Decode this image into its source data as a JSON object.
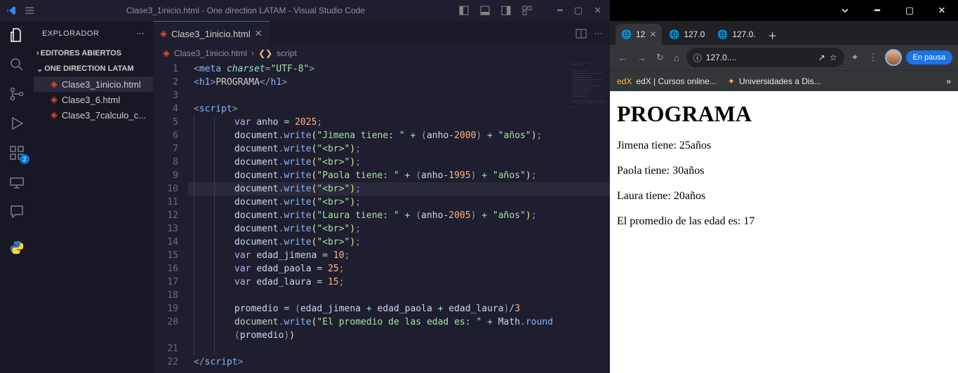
{
  "vscode": {
    "title": "Clase3_1inicio.html - One direction LATAM - Visual Studio Code",
    "explorer_label": "EXPLORADOR",
    "editors_open": "EDITORES ABIERTOS",
    "project_name": "ONE DIRECTION LATAM",
    "files": [
      "Clase3_1inicio.html",
      "Clase3_6.html",
      "Clase3_7calculo_c..."
    ],
    "tab_name": "Clase3_1inicio.html",
    "breadcrumb_file": "Clase3_1inicio.html",
    "breadcrumb_symbol": "script",
    "badge": "2",
    "lines": [
      {
        "n": 1,
        "html": "<span class='punct'>&lt;</span><span class='tag'>meta</span> <span class='attr'>charset</span><span class='punct'>=</span><span class='str'>\"UTF-8\"</span><span class='punct'>&gt;</span>",
        "indent": 0
      },
      {
        "n": 2,
        "html": "<span class='punct'>&lt;</span><span class='tag'>h1</span><span class='punct'>&gt;</span>PROGRAMA<span class='punct'>&lt;/</span><span class='tag'>h1</span><span class='punct'>&gt;</span>",
        "indent": 0
      },
      {
        "n": 3,
        "html": "",
        "indent": 0
      },
      {
        "n": 4,
        "html": "<span class='punct'>&lt;</span><span class='tag'>script</span><span class='punct'>&gt;</span>",
        "indent": 0
      },
      {
        "n": 5,
        "html": "<span class='kw'>var</span> <span class='var'>anho</span> <span class='op'>=</span> <span class='num'>2025</span><span class='punct'>;</span>",
        "indent": 2
      },
      {
        "n": 6,
        "html": "<span class='obj'>document</span><span class='punct'>.</span><span class='fn'>write</span><span class='bracket'>(</span><span class='str'>\"Jimena tiene: \"</span> <span class='op'>+</span> <span class='punct'>(</span><span class='var'>anho</span><span class='op'>-</span><span class='num'>2000</span><span class='punct'>)</span> <span class='op'>+</span> <span class='str'>\"años\"</span><span class='bracket'>)</span><span class='punct'>;</span>",
        "indent": 2
      },
      {
        "n": 7,
        "html": "<span class='obj'>document</span><span class='punct'>.</span><span class='fn'>write</span><span class='bracket'>(</span><span class='str'>\"&lt;br&gt;\"</span><span class='bracket'>)</span><span class='punct'>;</span>",
        "indent": 2
      },
      {
        "n": 8,
        "html": "<span class='obj'>document</span><span class='punct'>.</span><span class='fn'>write</span><span class='bracket'>(</span><span class='str'>\"&lt;br&gt;\"</span><span class='bracket'>)</span><span class='punct'>;</span>",
        "indent": 2
      },
      {
        "n": 9,
        "html": "<span class='obj'>document</span><span class='punct'>.</span><span class='fn'>write</span><span class='bracket'>(</span><span class='str'>\"Paola tiene: \"</span> <span class='op'>+</span> <span class='punct'>(</span><span class='var'>anho</span><span class='op'>-</span><span class='num'>1995</span><span class='punct'>)</span> <span class='op'>+</span> <span class='str'>\"años\"</span><span class='bracket'>)</span><span class='punct'>;</span>",
        "indent": 2
      },
      {
        "n": 10,
        "html": "<span class='obj'>document</span><span class='punct'>.</span><span class='fn'>write</span><span class='bracket'>(</span><span class='str'>\"&lt;br&gt;\"</span><span class='bracket'>)</span><span class='punct'>;</span>",
        "indent": 2,
        "hl": true
      },
      {
        "n": 11,
        "html": "<span class='obj'>document</span><span class='punct'>.</span><span class='fn'>write</span><span class='bracket'>(</span><span class='str'>\"&lt;br&gt;\"</span><span class='bracket'>)</span><span class='punct'>;</span>",
        "indent": 2
      },
      {
        "n": 12,
        "html": "<span class='obj'>document</span><span class='punct'>.</span><span class='fn'>write</span><span class='bracket'>(</span><span class='str'>\"Laura tiene: \"</span> <span class='op'>+</span> <span class='punct'>(</span><span class='var'>anho</span><span class='op'>-</span><span class='num'>2005</span><span class='punct'>)</span> <span class='op'>+</span> <span class='str'>\"años\"</span><span class='bracket'>)</span><span class='punct'>;</span>",
        "indent": 2
      },
      {
        "n": 13,
        "html": "<span class='obj'>document</span><span class='punct'>.</span><span class='fn'>write</span><span class='bracket'>(</span><span class='str'>\"&lt;br&gt;\"</span><span class='bracket'>)</span><span class='punct'>;</span>",
        "indent": 2
      },
      {
        "n": 14,
        "html": "<span class='obj'>document</span><span class='punct'>.</span><span class='fn'>write</span><span class='bracket'>(</span><span class='str'>\"&lt;br&gt;\"</span><span class='bracket'>)</span><span class='punct'>;</span>",
        "indent": 2
      },
      {
        "n": 15,
        "html": "<span class='kw'>var</span> <span class='var'>edad_jimena</span> <span class='op'>=</span> <span class='num'>10</span><span class='punct'>;</span>",
        "indent": 2
      },
      {
        "n": 16,
        "html": "<span class='kw'>var</span> <span class='var'>edad_paola</span> <span class='op'>=</span> <span class='num'>25</span><span class='punct'>;</span>",
        "indent": 2
      },
      {
        "n": 17,
        "html": "<span class='kw'>var</span> <span class='var'>edad_laura</span> <span class='op'>=</span> <span class='num'>15</span><span class='punct'>;</span>",
        "indent": 2
      },
      {
        "n": 18,
        "html": "",
        "indent": 2
      },
      {
        "n": 19,
        "html": "<span class='var'>promedio</span> <span class='op'>=</span> <span class='punct'>(</span><span class='var'>edad_jimena</span> <span class='op'>+</span> <span class='var'>edad_paola</span> <span class='op'>+</span> <span class='var'>edad_laura</span><span class='punct'>)</span><span class='op'>/</span><span class='num'>3</span>",
        "indent": 2
      },
      {
        "n": 20,
        "html": "<span class='obj'>document</span><span class='punct'>.</span><span class='fn'>write</span><span class='bracket'>(</span><span class='str'>\"El promedio de las edad es: \"</span> <span class='op'>+</span> <span class='var'>Math</span><span class='punct'>.</span><span class='fn'>round</span><span class='punct'>(</span><span class='var'>promedio</span><span class='punct'>)</span><span class='bracket'>)</span>",
        "indent": 2,
        "wrap": true
      },
      {
        "n": 21,
        "html": "",
        "indent": 2
      },
      {
        "n": 22,
        "html": "<span class='punct'>&lt;/</span><span class='tag'>script</span><span class='punct'>&gt;</span>",
        "indent": 0
      }
    ]
  },
  "browser": {
    "tabs": [
      {
        "label": "12",
        "active": true
      },
      {
        "label": "127.0",
        "active": false
      },
      {
        "label": "127.0.",
        "active": false
      }
    ],
    "address": "127.0....",
    "pause_label": "En pausa",
    "bookmarks": [
      {
        "label": "edX | Cursos online...",
        "icon": "edX"
      },
      {
        "label": "Universidades a Dis...",
        "icon": "✦"
      }
    ],
    "page_title": "PROGRAMA",
    "page_lines": [
      "Jimena tiene: 25años",
      "Paola tiene: 30años",
      "Laura tiene: 20años",
      "El promedio de las edad es: 17"
    ]
  }
}
